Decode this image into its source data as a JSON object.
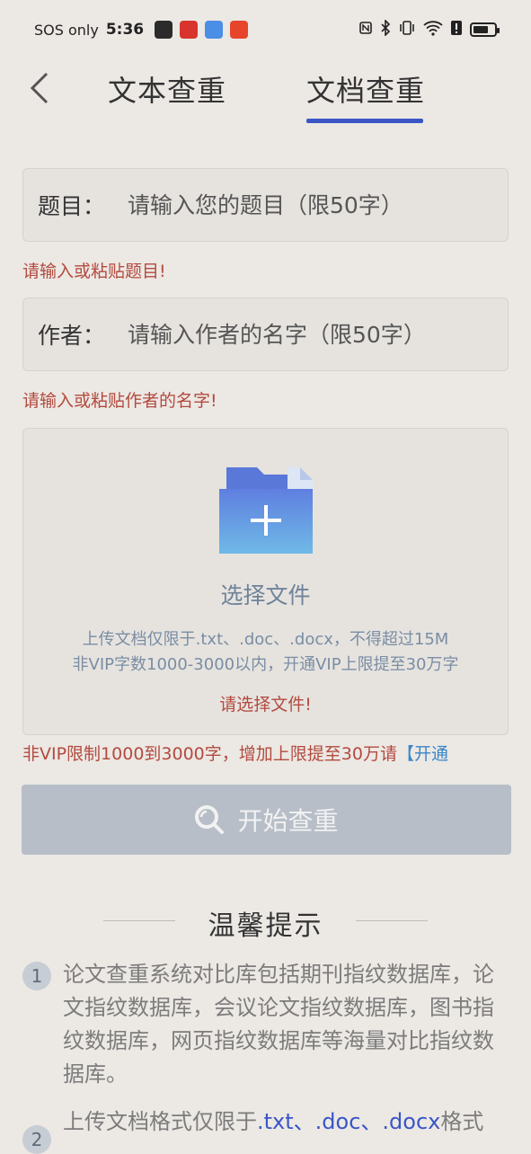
{
  "status_bar": {
    "carrier": "SOS only",
    "time": "5:36",
    "battery_level": 0.62
  },
  "tabs": {
    "items": [
      {
        "label": "文本查重",
        "active": false
      },
      {
        "label": "文档查重",
        "active": true
      }
    ],
    "accent_color": "#3a56c6"
  },
  "title_field": {
    "label": "题目：",
    "placeholder": "请输入您的题目（限50字）",
    "error": "请输入或粘贴题目!"
  },
  "author_field": {
    "label": "作者：",
    "placeholder": "请输入作者的名字（限50字）",
    "error": "请输入或粘贴作者的名字!"
  },
  "upload": {
    "select_label": "选择文件",
    "hint_line1": "上传文档仅限于.txt、.doc、.docx，不得超过15M",
    "hint_line2": "非VIP字数1000-3000以内，开通VIP上限提至30万字",
    "error": "请选择文件!"
  },
  "limit_note": {
    "text": "非VIP限制1000到3000字，增加上限提至30万请",
    "link": "【开通"
  },
  "start_button": {
    "label": "开始查重"
  },
  "tips": {
    "title": "温馨提示",
    "items": [
      {
        "num": "1",
        "text": "论文查重系统对比库包括期刊指纹数据库，论文指纹数据库，会议论文指纹数据库，图书指纹数据库，网页指纹数据库等海量对比指纹数据库。"
      },
      {
        "num": "2",
        "text_before": "上传文档格式仅限于",
        "highlight": ".txt、.doc、.docx",
        "text_after": "格式"
      }
    ]
  }
}
